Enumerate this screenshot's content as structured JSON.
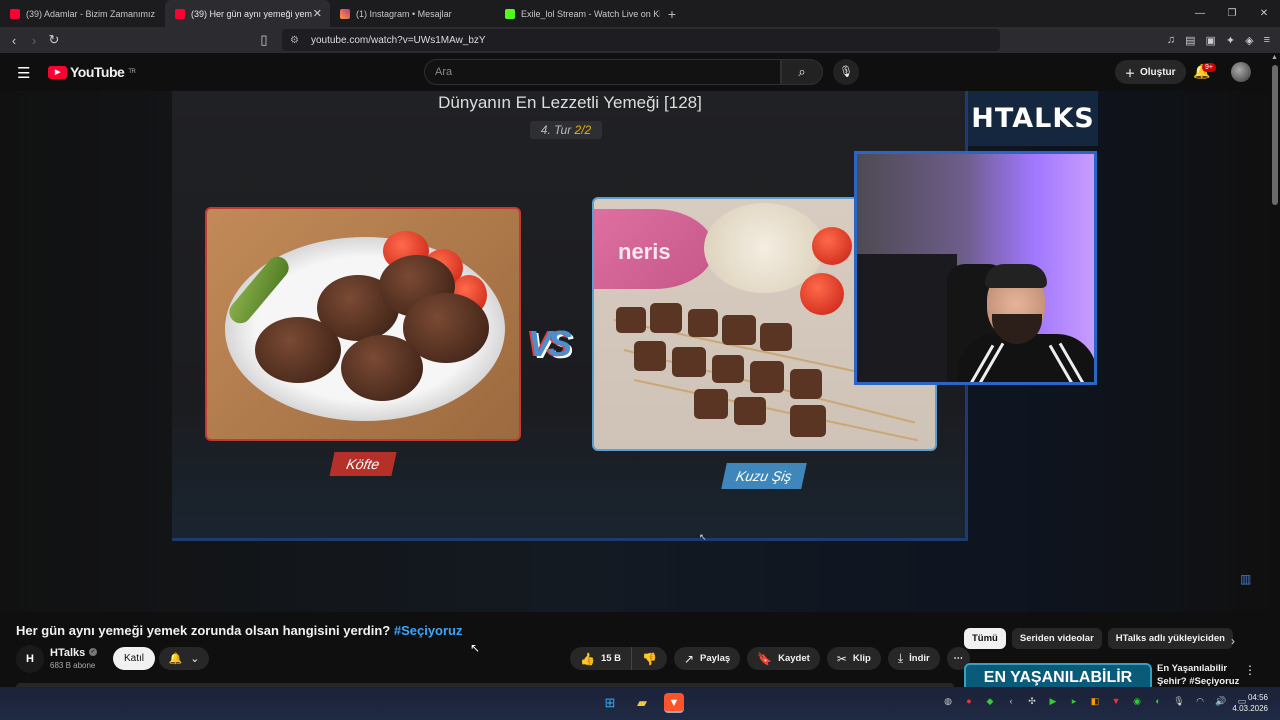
{
  "browser": {
    "tabs": [
      {
        "title": "(39) Adamlar - Bizim Zamanımız",
        "color": "#ff0033"
      },
      {
        "title": "(39) Her gün aynı yemeği yem",
        "color": "#ff0033"
      },
      {
        "title": "(1) Instagram • Mesajlar",
        "color": "#c13584"
      },
      {
        "title": "Exile_lol Stream - Watch Live on Kick",
        "color": "#53fc18"
      }
    ],
    "new_tab": "+",
    "url": "youtube.com/watch?v=UWs1MAw_bzY"
  },
  "youtube": {
    "logo": "YouTube",
    "region": "TR",
    "search_placeholder": "Ara",
    "create_label": "Oluştur",
    "notif_count": "9+"
  },
  "video": {
    "stage_title": "Dünyanın En Lezzetli Yemeği [128]",
    "round_prefix": "4. Tur ",
    "round_value": "2/2",
    "left_food": "Köfte",
    "right_food": "Kuzu Şiş",
    "vs": "VS",
    "brand": "HTALKS",
    "plate_brand": "neris"
  },
  "details": {
    "title": "Her gün aynı yemeği yemek zorunda olsan hangisini yerdin?",
    "hashtag": "#Seçiyoruz",
    "channel": "HTalks",
    "subscribers": "683 B abone",
    "join": "Katıl",
    "likes": "15 B",
    "share": "Paylaş",
    "save": "Kaydet",
    "clip": "Klip",
    "download": "İndir"
  },
  "recommendations": {
    "chips": [
      "Tümü",
      "Seriden videolar",
      "HTalks adlı yükleyiciden"
    ],
    "first_thumb_text": "EN YAŞANILABİLİR ŞEHİR",
    "first_title": "En Yaşanılabilir Şehir? #Seçiyoruz"
  },
  "taskbar": {
    "time": "04:56",
    "date": "4.03.2026"
  }
}
